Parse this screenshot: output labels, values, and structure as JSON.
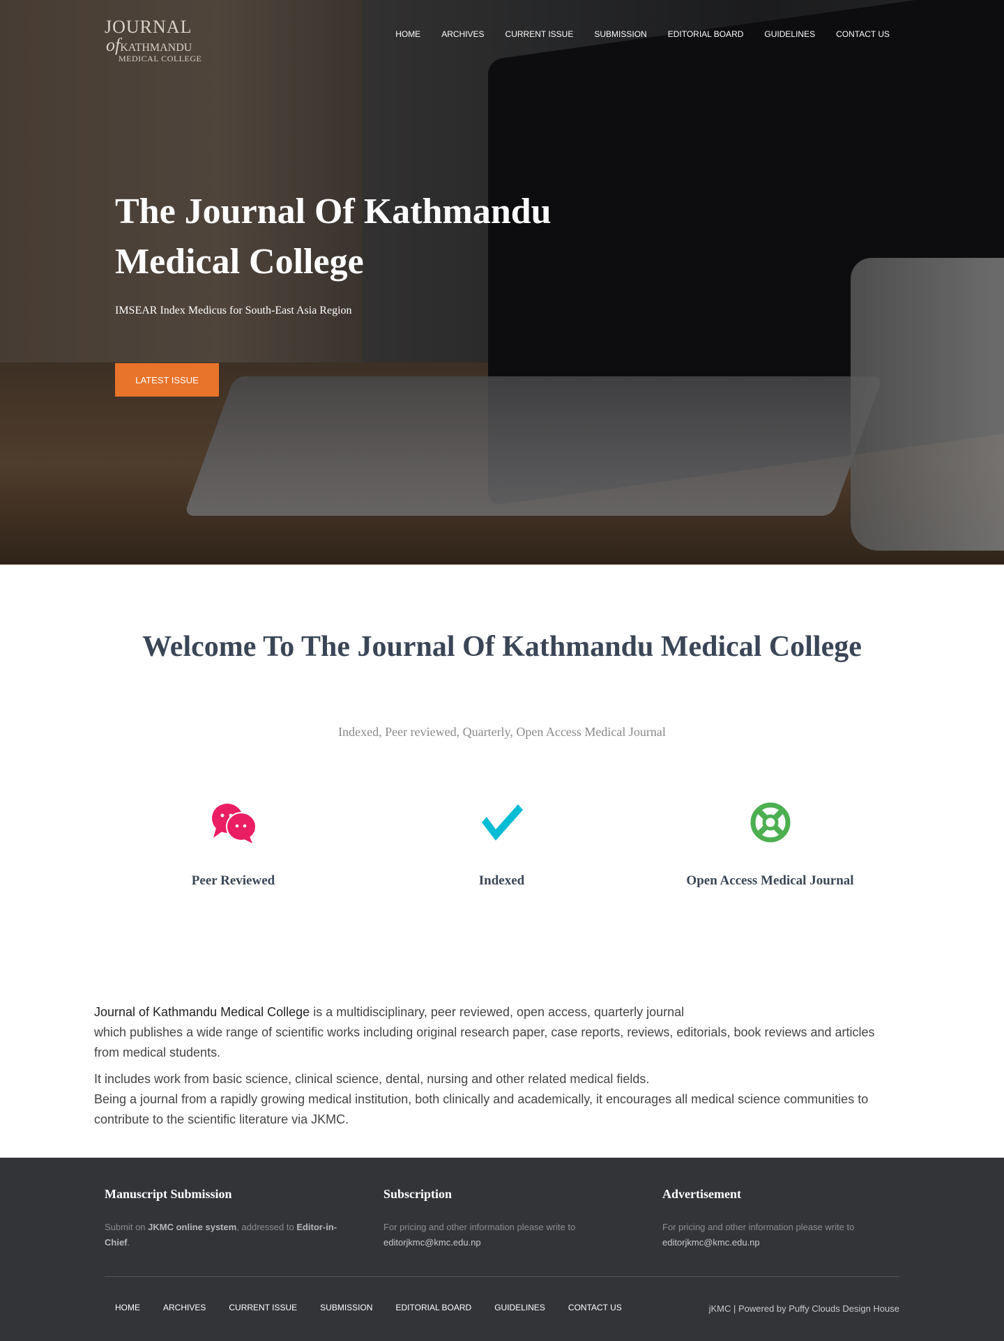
{
  "header": {
    "logo": {
      "line1": "JOURNAL",
      "of": "of",
      "line2": "KATHMANDU",
      "line3": "MEDICAL COLLEGE"
    },
    "nav": [
      "HOME",
      "ARCHIVES",
      "CURRENT ISSUE",
      "SUBMISSION",
      "EDITORIAL BOARD",
      "GUIDELINES",
      "CONTACT US"
    ]
  },
  "hero": {
    "title": "The Journal Of Kathmandu Medical College",
    "subtitle": "IMSEAR Index Medicus for South-East Asia Region",
    "button": "LATEST ISSUE",
    "button_color": "#e8732a"
  },
  "welcome": {
    "title": "Welcome To The Journal Of Kathmandu Medical College",
    "subtitle": "Indexed, Peer reviewed, Quarterly, Open Access Medical Journal"
  },
  "features": [
    {
      "icon": "chat-bubbles-icon",
      "color": "#e91e63",
      "label": "Peer Reviewed"
    },
    {
      "icon": "checkmark-icon",
      "color": "#00bcd4",
      "label": "Indexed"
    },
    {
      "icon": "life-ring-icon",
      "color": "#4caf50",
      "label": "Open Access Medical Journal"
    }
  ],
  "about": {
    "bold": "Journal of Kathmandu Medical College",
    "p1": " is a multidisciplinary, peer reviewed, open access, quarterly journal",
    "p1b": "which publishes a wide range of scientific works including original research paper, case reports, reviews, editorials, book reviews and articles from medical students.",
    "p2": "It includes work from basic science, clinical science, dental, nursing and other related medical fields.",
    "p3": "Being a journal from a rapidly growing medical institution, both clinically and academically, it encourages all medical science communities to contribute to the scientific literature via JKMC."
  },
  "footer": {
    "manuscript": {
      "title": "Manuscript Submission",
      "t1": "Submit on ",
      "link": "JKMC online system",
      "t2": ", addressed to ",
      "b2": "Editor-in-Chief",
      "t3": "."
    },
    "subscription": {
      "title": "Subscription",
      "text": "For pricing and other information please write to",
      "email": "editorjkmc@kmc.edu.np"
    },
    "advertisement": {
      "title": "Advertisement",
      "text": "For pricing and other information please write to",
      "email": "editorjkmc@kmc.edu.np"
    },
    "nav": [
      "HOME",
      "ARCHIVES",
      "CURRENT ISSUE",
      "SUBMISSION",
      "EDITORIAL BOARD",
      "GUIDELINES",
      "CONTACT US"
    ],
    "credit_prefix": "jKMC | Powered by ",
    "credit_link": "Puffy Clouds Design House",
    "bg": "#333438"
  }
}
